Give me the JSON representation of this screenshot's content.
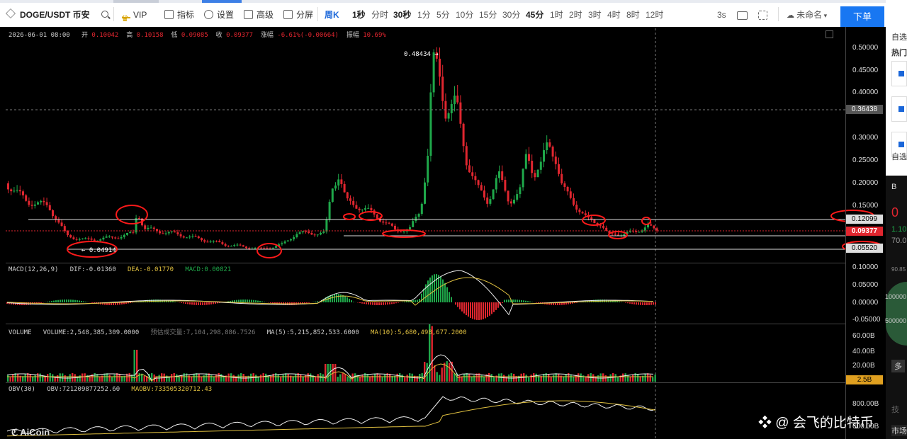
{
  "toolbar": {
    "symbol": "DOGE/USDT 币安",
    "vip": "VIP",
    "indicators": "指标",
    "settings": "设置",
    "advanced": "高级",
    "split": "分屏",
    "periods": [
      "周K",
      "1秒",
      "分时",
      "30秒",
      "1分",
      "5分",
      "10分",
      "15分",
      "30分",
      "45分",
      "1时",
      "2时",
      "3时",
      "4时",
      "8时",
      "12时"
    ],
    "interval": "3s",
    "unnamed": "未命名",
    "order": "下单"
  },
  "right_panel": {
    "select_all": "自选",
    "hot": "热门",
    "b": "B",
    "price_short": "0",
    "pct": "1.10",
    "two_to": "70.0",
    "p90": "90.85",
    "v100": "100000",
    "v500": "500000",
    "duo": "多",
    "ji": "技",
    "shi": "市场"
  },
  "ohlc": {
    "datetime": "2026-06-01 08:00",
    "open_label": "开",
    "open": "0.10042",
    "high_label": "高",
    "high": "0.10158",
    "low_label": "低",
    "low": "0.09085",
    "close_label": "收",
    "close": "0.09377",
    "change_label": "涨幅",
    "change": "-6.61%(-0.00664)",
    "amp_label": "振幅",
    "amp": "10.69%"
  },
  "price_axis": [
    "0.50000",
    "0.45000",
    "0.40000",
    "0.35000",
    "0.30000",
    "0.25000",
    "0.20000",
    "0.15000",
    "0.10000",
    "0.05000"
  ],
  "marks": {
    "high_mark": "0.48434",
    "low_mark": "0.04914",
    "crosshair": "0.36438",
    "line_upper": "0.12099",
    "current": "0.09377",
    "line_lower": "0.05520"
  },
  "macd": {
    "title": "MACD(12,26,9)",
    "dif": "DIF:-0.01360",
    "dea": "DEA:-0.01770",
    "macd": "MACD:0.00821",
    "axis": [
      "0.10000",
      "0.05000",
      "0.00000",
      "-0.05000"
    ]
  },
  "volume": {
    "title": "VOLUME",
    "volume": "VOLUME:2,548,385,309.0000",
    "estimate": "预估成交量:7,104,298,886.7526",
    "ma5": "MA(5):5,215,852,533.6000",
    "ma10": "MA(10):5,680,498,677.2000",
    "axis": [
      "60.00B",
      "40.00B",
      "20.00B"
    ],
    "current": "2.5B"
  },
  "obv": {
    "title": "OBV(30)",
    "obv": "OBV:721209877252.60",
    "maobv": "MAOBV:733505320712.43",
    "axis": [
      "800.00B",
      "600.00B"
    ]
  },
  "watermark": {
    "logo": "AiCoin",
    "author": "@ 会飞的比特币"
  },
  "colors": {
    "up": "#1fa84a",
    "down": "#e0262f",
    "accent": "#1877f2",
    "annotation": "#ff1a1a"
  }
}
